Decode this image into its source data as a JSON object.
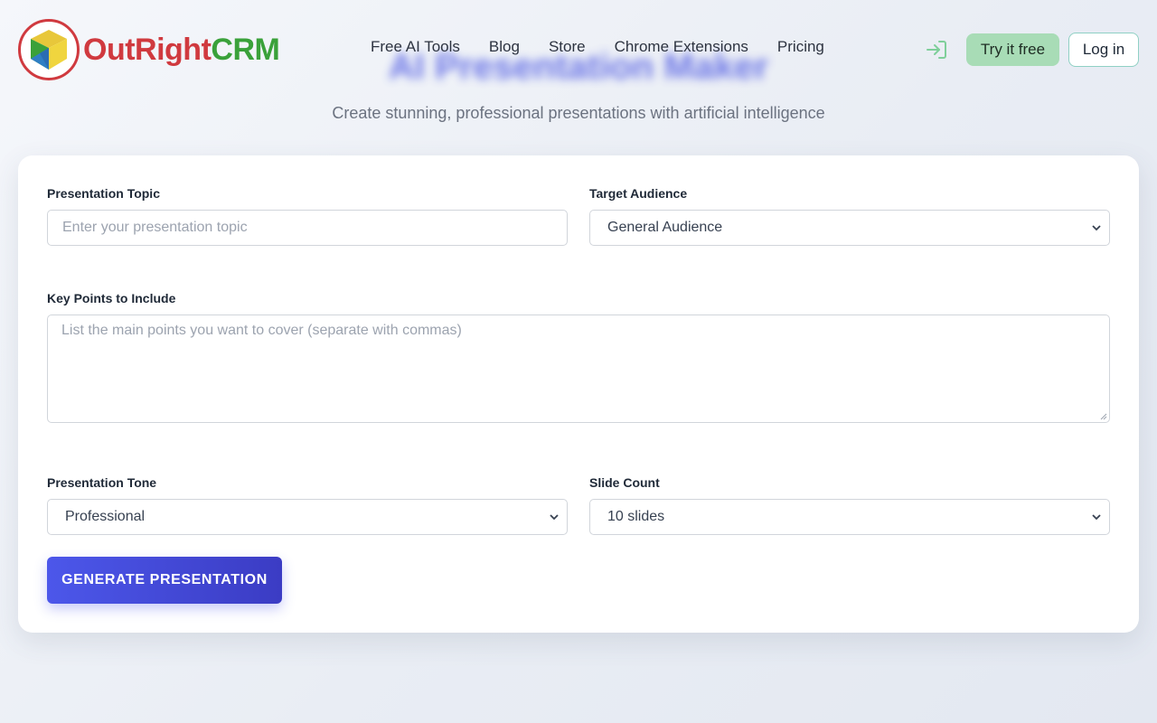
{
  "brand": {
    "logo_text_1": "OutRight",
    "logo_text_2": "CRM",
    "colors": {
      "red": "#d03a3f",
      "green": "#3aa13a",
      "accent": "#4c57ea"
    }
  },
  "nav": {
    "links": [
      "Free AI Tools",
      "Blog",
      "Store",
      "Chrome Extensions",
      "Pricing"
    ],
    "login_icon": "sign-in-icon",
    "try_free": "Try it free",
    "login": "Log in"
  },
  "hero": {
    "title": "AI Presentation Maker",
    "subtitle": "Create stunning, professional presentations with artificial intelligence"
  },
  "form": {
    "topic": {
      "label": "Presentation Topic",
      "placeholder": "Enter your presentation topic"
    },
    "audience": {
      "label": "Target Audience",
      "value": "General Audience"
    },
    "key_points": {
      "label": "Key Points to Include",
      "placeholder": "List the main points you want to cover (separate with commas)"
    },
    "tone": {
      "label": "Presentation Tone",
      "value": "Professional"
    },
    "slides": {
      "label": "Slide Count",
      "value": "10 slides"
    },
    "submit": "GENERATE PRESENTATION"
  }
}
